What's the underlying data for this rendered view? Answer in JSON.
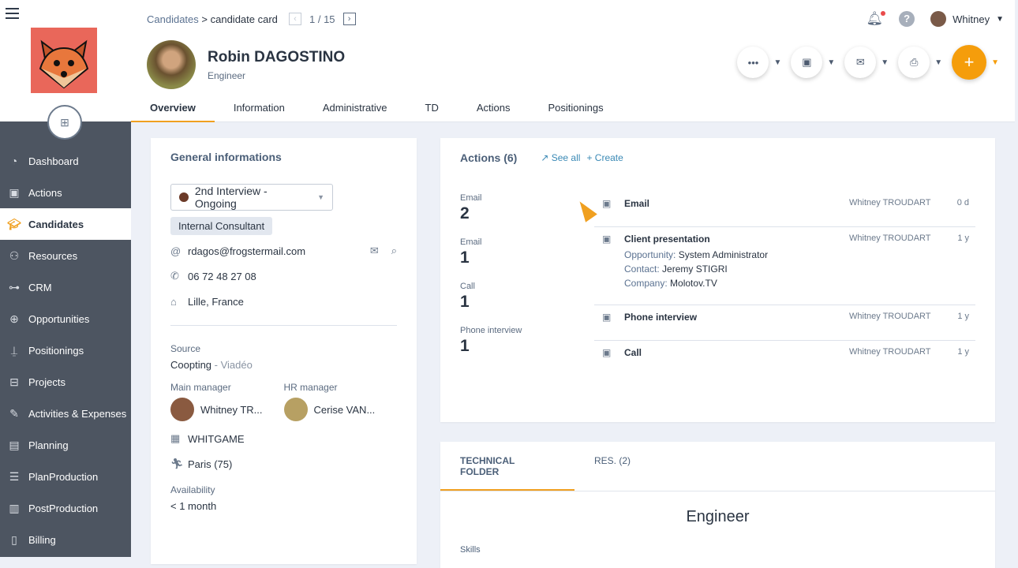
{
  "sidebar": {
    "items": [
      {
        "label": "Dashboard",
        "icon": "gauge-icon"
      },
      {
        "label": "Actions",
        "icon": "calendar-edit-icon"
      },
      {
        "label": "Candidates",
        "icon": "graduation-cap-icon",
        "active": true
      },
      {
        "label": "Resources",
        "icon": "users-icon"
      },
      {
        "label": "CRM",
        "icon": "org-chart-icon"
      },
      {
        "label": "Opportunities",
        "icon": "crosshair-icon"
      },
      {
        "label": "Positionings",
        "icon": "pin-icon"
      },
      {
        "label": "Projects",
        "icon": "briefcase-icon"
      },
      {
        "label": "Activities & Expenses",
        "icon": "edit-icon"
      },
      {
        "label": "Planning",
        "icon": "calendar-icon"
      },
      {
        "label": "PlanProduction",
        "icon": "bar-chart-icon"
      },
      {
        "label": "PostProduction",
        "icon": "calculator-icon"
      },
      {
        "label": "Billing",
        "icon": "invoice-icon"
      }
    ]
  },
  "header": {
    "breadcrumb_root": "Candidates",
    "breadcrumb_current": "> candidate card",
    "pager": "1 / 15",
    "name": "Robin DAGOSTINO",
    "role": "Engineer",
    "user": "Whitney",
    "tabs": [
      "Overview",
      "Information",
      "Administrative",
      "TD",
      "Actions",
      "Positionings"
    ]
  },
  "general": {
    "title": "General informations",
    "status": "2nd Interview - Ongoing",
    "status_color": "#6b3a28",
    "tag": "Internal Consultant",
    "email": "rdagos@frogstermail.com",
    "phone": "06 72 48 27 08",
    "address": "Lille, France",
    "source_label": "Source",
    "source": "Coopting",
    "source_detail": "- Viadéo",
    "main_manager_label": "Main manager",
    "main_manager": "Whitney TR...",
    "hr_manager_label": "HR manager",
    "hr_manager": "Cerise VAN...",
    "company": "WHITGAME",
    "mobility": "Paris (75)",
    "availability_label": "Availability",
    "availability": "< 1 month"
  },
  "actions": {
    "title": "Actions (6)",
    "see_all": "See all",
    "create": "+ Create",
    "counts": [
      {
        "label": "Email",
        "n": "2"
      },
      {
        "label": "Email",
        "n": "1"
      },
      {
        "label": "Call",
        "n": "1"
      },
      {
        "label": "Phone interview",
        "n": "1"
      }
    ],
    "items": [
      {
        "title": "Email",
        "who": "Whitney TROUDART",
        "age": "0 d",
        "details": []
      },
      {
        "title": "Client presentation",
        "who": "Whitney TROUDART",
        "age": "1 y",
        "details": [
          {
            "k": "Opportunity:",
            "v": "System Administrator"
          },
          {
            "k": "Contact:",
            "v": "Jeremy STIGRI"
          },
          {
            "k": "Company:",
            "v": "Molotov.TV"
          }
        ]
      },
      {
        "title": "Phone interview",
        "who": "Whitney TROUDART",
        "age": "1 y",
        "details": []
      },
      {
        "title": "Call",
        "who": "Whitney TROUDART",
        "age": "1 y",
        "details": []
      }
    ]
  },
  "folder": {
    "tabs": [
      "TECHNICAL FOLDER",
      "RES. (2)"
    ],
    "title": "Engineer",
    "skills_label": "Skills"
  }
}
